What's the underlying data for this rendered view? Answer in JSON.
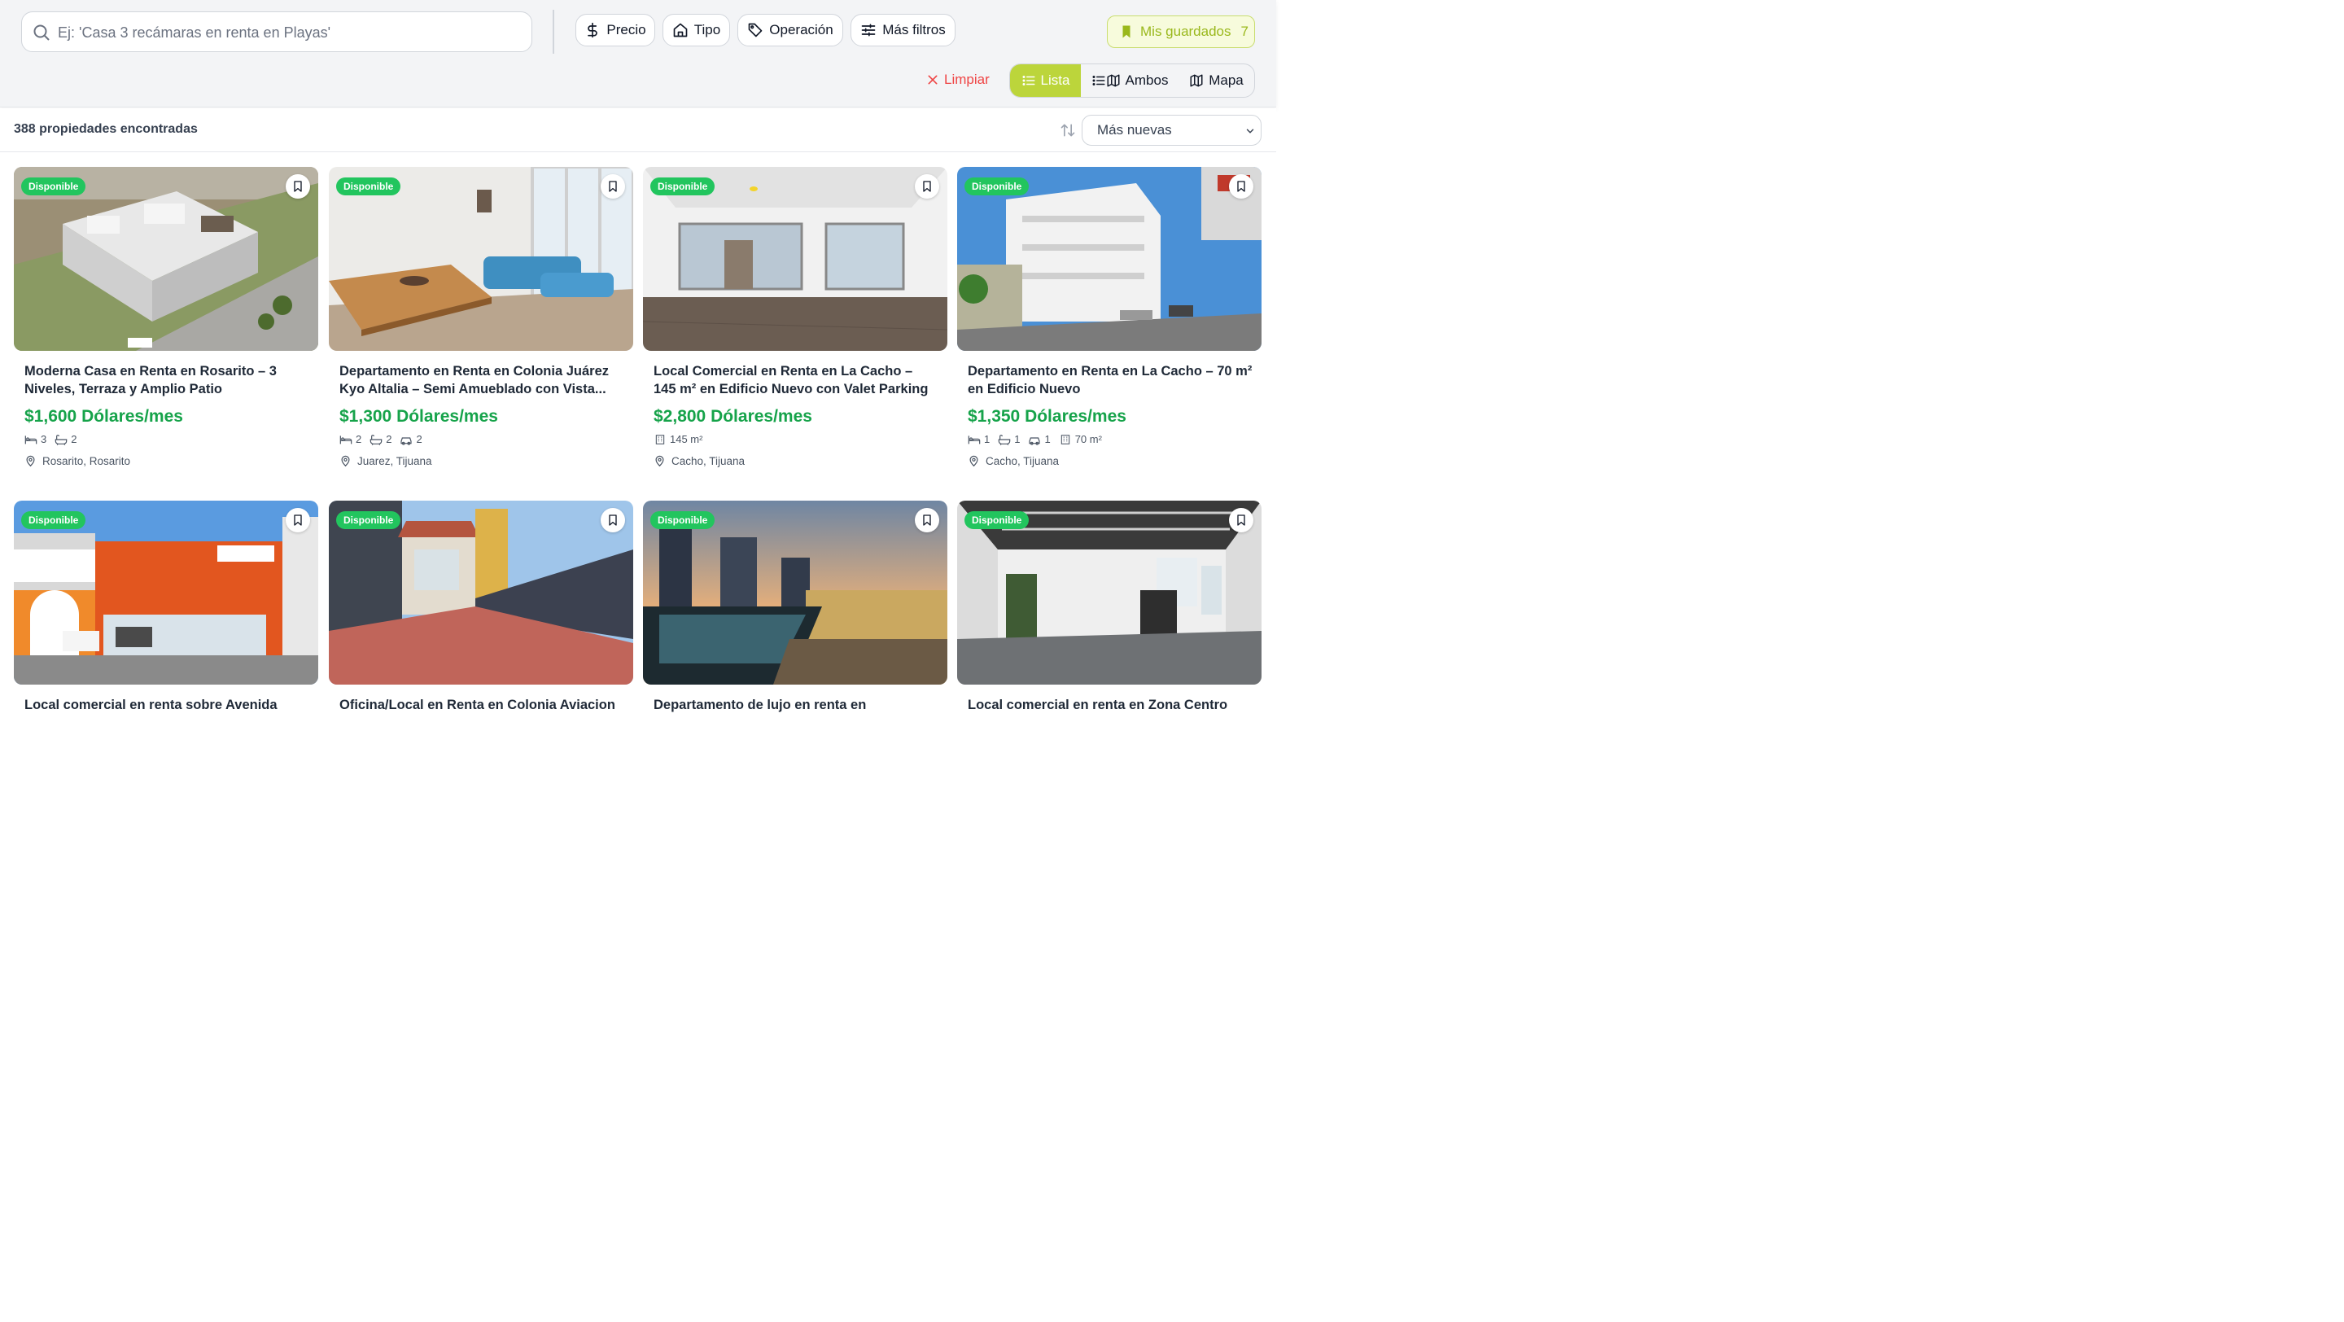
{
  "search": {
    "placeholder": "Ej: 'Casa 3 recámaras en renta en Playas'"
  },
  "filters": {
    "precio": "Precio",
    "tipo": "Tipo",
    "operacion": "Operación",
    "mas_filtros": "Más filtros"
  },
  "saved": {
    "label": "Mis guardados",
    "count": "7"
  },
  "clear_label": "Limpiar",
  "view": {
    "lista": "Lista",
    "ambos": "Ambos",
    "mapa": "Mapa",
    "active": "Lista"
  },
  "results": {
    "count_text": "388 propiedades encontradas",
    "sort_value": "Más nuevas"
  },
  "colors": {
    "accent": "#bcd53b",
    "price": "#16a34a",
    "badge": "#22c55e",
    "clear": "#ef4444"
  },
  "listings": [
    {
      "badge": "Disponible",
      "title": "Moderna Casa en Renta en Rosarito – 3 Niveles, Terraza y Amplio Patio",
      "price": "$1,600 Dólares/mes",
      "features": [
        {
          "icon": "bed-icon",
          "value": "3"
        },
        {
          "icon": "bath-icon",
          "value": "2"
        }
      ],
      "location": "Rosarito, Rosarito"
    },
    {
      "badge": "Disponible",
      "title": "Departamento en Renta en Colonia Juárez Kyo Altalia – Semi Amueblado con Vista...",
      "price": "$1,300 Dólares/mes",
      "features": [
        {
          "icon": "bed-icon",
          "value": "2"
        },
        {
          "icon": "bath-icon",
          "value": "2"
        },
        {
          "icon": "car-icon",
          "value": "2"
        }
      ],
      "location": "Juarez, Tijuana"
    },
    {
      "badge": "Disponible",
      "title": "Local Comercial en Renta en La Cacho – 145 m² en Edificio Nuevo con Valet Parking",
      "price": "$2,800 Dólares/mes",
      "features": [
        {
          "icon": "building-icon",
          "value": "145 m²"
        }
      ],
      "location": "Cacho, Tijuana"
    },
    {
      "badge": "Disponible",
      "title": "Departamento en Renta en La Cacho – 70 m² en Edificio Nuevo",
      "price": "$1,350 Dólares/mes",
      "features": [
        {
          "icon": "bed-icon",
          "value": "1"
        },
        {
          "icon": "bath-icon",
          "value": "1"
        },
        {
          "icon": "car-icon",
          "value": "1"
        },
        {
          "icon": "building-icon",
          "value": "70 m²"
        }
      ],
      "location": "Cacho, Tijuana"
    },
    {
      "badge": "Disponible",
      "title": "Local comercial en renta sobre Avenida",
      "price": "",
      "features": [],
      "location": ""
    },
    {
      "badge": "Disponible",
      "title": "Oficina/Local en Renta en Colonia Aviacion",
      "price": "",
      "features": [],
      "location": ""
    },
    {
      "badge": "Disponible",
      "title": "Departamento de lujo en renta en",
      "price": "",
      "features": [],
      "location": ""
    },
    {
      "badge": "Disponible",
      "title": "Local comercial en renta en Zona Centro",
      "price": "",
      "features": [],
      "location": ""
    }
  ]
}
